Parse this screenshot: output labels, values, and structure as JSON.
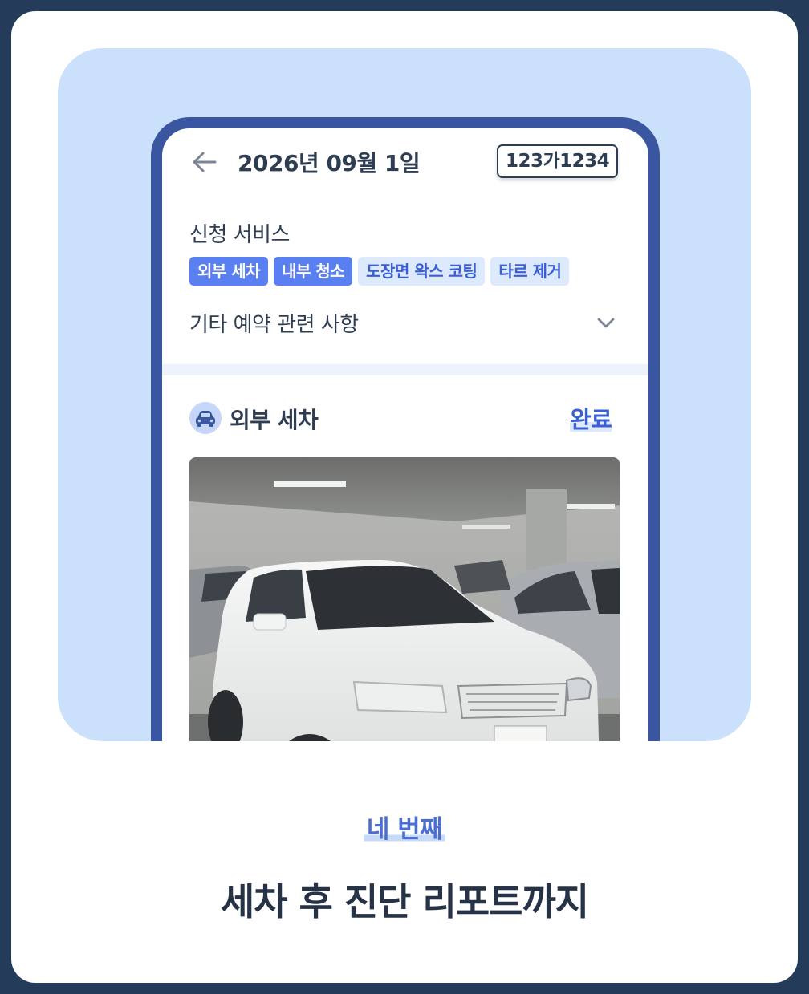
{
  "header": {
    "date": "2026년 09월 1일",
    "plate_number": "123가1234",
    "back_icon": "arrow-left-icon"
  },
  "services": {
    "title": "신청 서비스",
    "chips": [
      {
        "label": "외부 세차",
        "selected": true
      },
      {
        "label": "내부 청소",
        "selected": true
      },
      {
        "label": "도장면 왁스 코팅",
        "selected": false
      },
      {
        "label": "타르 제거",
        "selected": false
      }
    ]
  },
  "etc_section": {
    "label": "기타 예약 관련 사항",
    "icon": "chevron-down-icon"
  },
  "exterior_wash": {
    "icon": "car-icon",
    "title": "외부 세차",
    "status": "완료"
  },
  "caption": {
    "step": "네 번째",
    "headline": "세차 후 진단 리포트까지"
  },
  "colors": {
    "frame": "#243b5a",
    "hero_bg": "#cbe0fb",
    "phone_border": "#3b56a1",
    "accent": "#3a5ed6",
    "chip_on": "#5a7ff0",
    "chip_off": "#dde9fc"
  }
}
